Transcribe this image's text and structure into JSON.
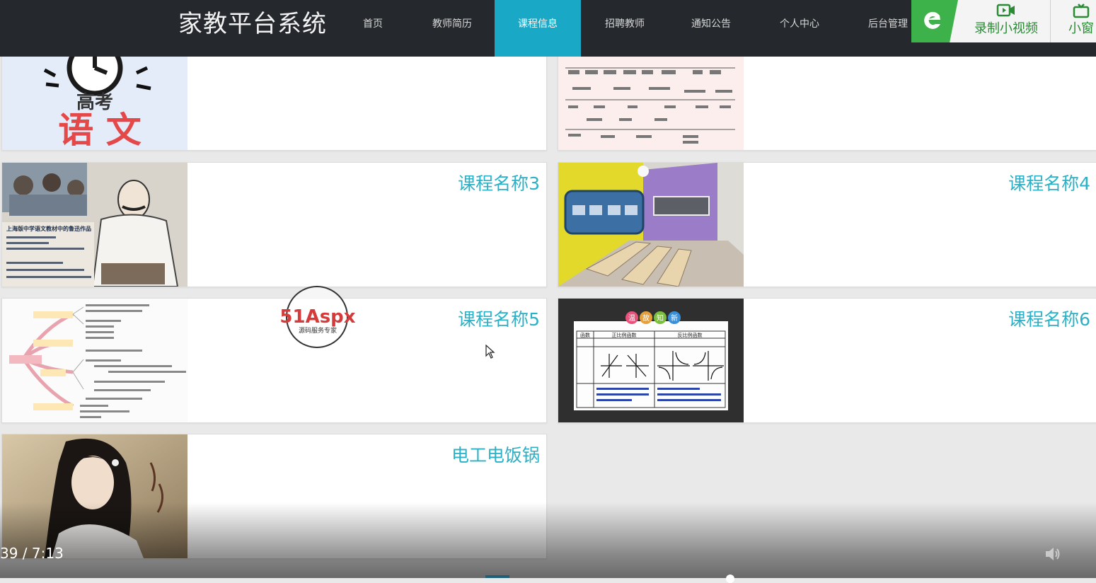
{
  "nav": {
    "brand": "家教平台系统",
    "items": [
      {
        "label": "首页"
      },
      {
        "label": "教师简历"
      },
      {
        "label": "课程信息"
      },
      {
        "label": "招聘教师"
      },
      {
        "label": "通知公告"
      },
      {
        "label": "个人中心"
      },
      {
        "label": "后台管理"
      }
    ],
    "active_index": 2,
    "colors": {
      "bar": "#25292e",
      "active": "#1aa8c7"
    }
  },
  "toolbar": {
    "record_label": "录制小视频",
    "window_label": "小窗"
  },
  "cards": [
    {
      "title": "",
      "thumb": "gaokao-yuwen-clock-icon"
    },
    {
      "title": "",
      "thumb": "timeline-chart-image"
    },
    {
      "title": "课程名称3",
      "thumb": "lu-xun-illustration-image"
    },
    {
      "title": "课程名称4",
      "thumb": "classroom-photo-image"
    },
    {
      "title": "课程名称5",
      "thumb": "mind-map-image"
    },
    {
      "title": "课程名称6",
      "thumb": "function-table-image"
    },
    {
      "title": "电工电饭锅",
      "thumb": "portrait-painting-image"
    }
  ],
  "thumb_text": {
    "gaokao": "高考",
    "yuwen": "语 文",
    "luxun_caption": "上海版中学语文教材中的鲁迅作品",
    "wengu": [
      "温",
      "故",
      "知",
      "新"
    ],
    "table_head": [
      "函数",
      "正比例函数",
      "反比例函数"
    ]
  },
  "watermark": {
    "brand": "51Aspx",
    "tagline": "源码服务专家"
  },
  "video": {
    "time": "39 / 7:13"
  },
  "accent_color": "#2bb0c5"
}
